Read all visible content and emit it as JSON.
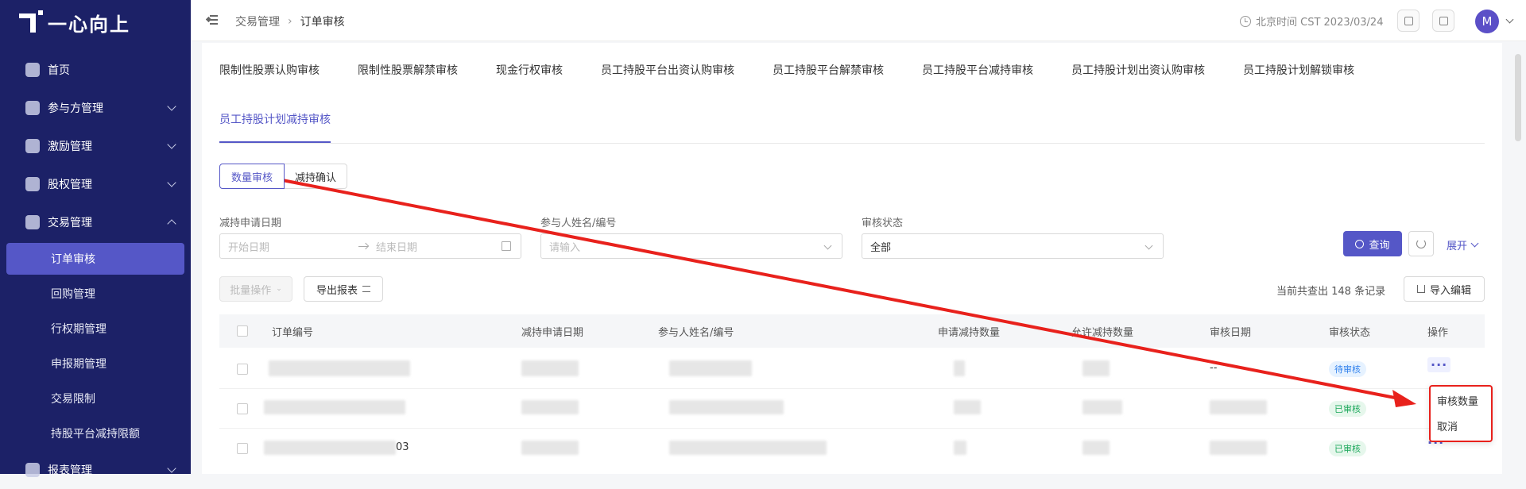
{
  "app": {
    "logo_text": "一心向上"
  },
  "sidebar": {
    "items": [
      {
        "label": "首页",
        "icon": "home-icon"
      },
      {
        "label": "参与方管理",
        "icon": "users-icon"
      },
      {
        "label": "激励管理",
        "icon": "gift-icon"
      },
      {
        "label": "股权管理",
        "icon": "pie-icon"
      },
      {
        "label": "交易管理",
        "icon": "trade-icon"
      }
    ],
    "sub_items": [
      {
        "label": "订单审核",
        "active": true
      },
      {
        "label": "回购管理"
      },
      {
        "label": "行权期管理"
      },
      {
        "label": "申报期管理"
      },
      {
        "label": "交易限制"
      },
      {
        "label": "持股平台减持限额"
      }
    ],
    "bottom_item": {
      "label": "报表管理",
      "icon": "report-icon"
    }
  },
  "topbar": {
    "breadcrumb": [
      "交易管理",
      "订单审核"
    ],
    "clock_text": "北京时间 CST 2023/03/24",
    "avatar_letter": "M"
  },
  "tabs": [
    "限制性股票认购审核",
    "限制性股票解禁审核",
    "现金行权审核",
    "员工持股平台出资认购审核",
    "员工持股平台解禁审核",
    "员工持股平台减持审核",
    "员工持股计划出资认购审核",
    "员工持股计划解锁审核",
    "员工持股计划减持审核"
  ],
  "segment": {
    "left": "数量审核",
    "right": "减持确认"
  },
  "filters": {
    "date_label": "减持申请日期",
    "date_start_placeholder": "开始日期",
    "date_end_placeholder": "结束日期",
    "person_label": "参与人姓名/编号",
    "person_placeholder": "请输入",
    "status_label": "审核状态",
    "status_value": "全部"
  },
  "actions": {
    "query": "查询",
    "expand": "展开",
    "batch": "批量操作",
    "export": "导出报表",
    "count_text": "当前共查出 148 条记录",
    "import": "导入编辑"
  },
  "table": {
    "headers": [
      "订单编号",
      "减持申请日期",
      "参与人姓名/编号",
      "申请减持数量",
      "允许减持数量",
      "审核日期",
      "审核状态",
      "操作"
    ],
    "rows": [
      {
        "review_date": "--",
        "status": "待审核",
        "status_type": "pending"
      },
      {
        "review_date": "",
        "status": "已审核",
        "status_type": "done"
      },
      {
        "order_suffix": "03",
        "review_date": "",
        "status": "已审核",
        "status_type": "done"
      }
    ],
    "more_symbol": "···"
  },
  "dropdown": {
    "items": [
      "审核数量",
      "取消"
    ]
  },
  "colors": {
    "sidebar_bg": "#1c2167",
    "primary": "#5557c7",
    "annotation": "#e8211c"
  }
}
